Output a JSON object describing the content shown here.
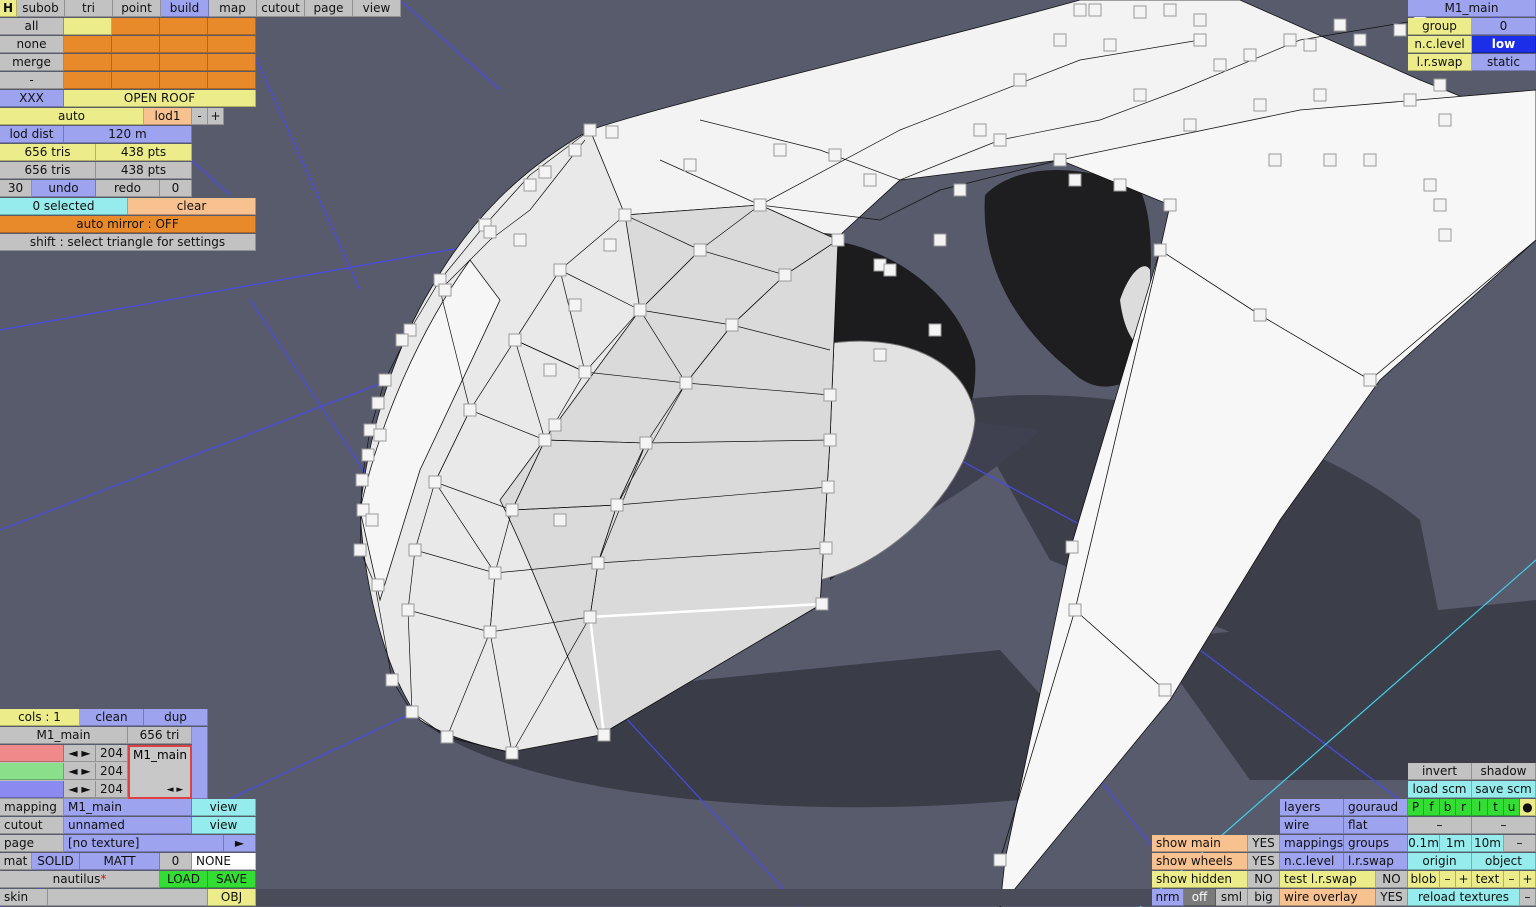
{
  "top_bar": {
    "h": "H",
    "tabs": [
      "subob",
      "tri",
      "point",
      "build",
      "map",
      "cutout",
      "page",
      "view"
    ],
    "active_tab": "build"
  },
  "select_panel": {
    "all": "all",
    "none": "none",
    "merge": "merge",
    "minus": "-",
    "xxx": "XXX",
    "open_roof": "OPEN ROOF",
    "auto": "auto",
    "lod": "lod1",
    "lod_minus": "-",
    "lod_plus": "+",
    "lod_dist_label": "lod dist",
    "lod_dist_value": "120 m",
    "tris1": "656 tris",
    "pts1": "438 pts",
    "tris2": "656 tris",
    "pts2": "438 pts",
    "undo_count": "30",
    "undo": "undo",
    "redo": "redo",
    "redo_count": "0",
    "selected": "0 selected",
    "clear": "clear",
    "auto_mirror": "auto mirror : OFF",
    "hint": "shift : select triangle for settings"
  },
  "right_panel": {
    "title": "M1_main",
    "group_label": "group",
    "group_value": "0",
    "nc_level_label": "n.c.level",
    "nc_level_value": "low",
    "lr_swap_label": "l.r.swap",
    "lr_swap_value": "static"
  },
  "bottom_left": {
    "cols": "cols : 1",
    "clean": "clean",
    "dup": "dup",
    "subobj_name": "M1_main",
    "subobj_tris": "656 tri",
    "rgb_values": [
      "204",
      "204",
      "204"
    ],
    "preview_label": "M1_main",
    "mapping_label": "mapping",
    "mapping_value": "M1_main",
    "mapping_view": "view",
    "cutout_label": "cutout",
    "cutout_value": "unnamed",
    "cutout_view": "view",
    "page_label": "page",
    "page_value": "[no texture]",
    "mat_label": "mat",
    "mat_solid": "SOLID",
    "mat_matt": "MATT",
    "mat_num": "0",
    "mat_none": "NONE",
    "file_name": "nautilus",
    "load": "LOAD",
    "save": "SAVE",
    "skin": "skin",
    "obj": "OBJ"
  },
  "bottom_right": {
    "show_main": "show main",
    "show_main_v": "YES",
    "show_wheels": "show wheels",
    "show_wheels_v": "YES",
    "show_hidden": "show hidden",
    "show_hidden_v": "NO",
    "nrm": "nrm",
    "off": "off",
    "sml": "sml",
    "big": "big",
    "layers": "layers",
    "gouraud": "gouraud",
    "wire": "wire",
    "flat": "flat",
    "mappings": "mappings",
    "groups": "groups",
    "nc_level": "n.c.level",
    "lr_swap": "l.r.swap",
    "test_lr_swap": "test l.r.swap",
    "test_lr_swap_v": "NO",
    "wire_overlay": "wire overlay",
    "wire_overlay_v": "YES",
    "invert": "invert",
    "shadow": "shadow",
    "load_scm": "load scm",
    "save_scm": "save scm",
    "flags": [
      "P",
      "f",
      "b",
      "r",
      "l",
      "t",
      "u"
    ],
    "flag_dot": "●",
    "dash1": "–",
    "dash2": "–",
    "d01": "0.1m",
    "d1": "1m",
    "d10": "10m",
    "dminus": "–",
    "origin": "origin",
    "object": "object",
    "blob": "blob",
    "blob_minus": "–",
    "blob_plus": "+",
    "text": "text",
    "text_minus": "–",
    "text_plus": "+",
    "reload": "reload textures",
    "reload_minus": "–"
  }
}
